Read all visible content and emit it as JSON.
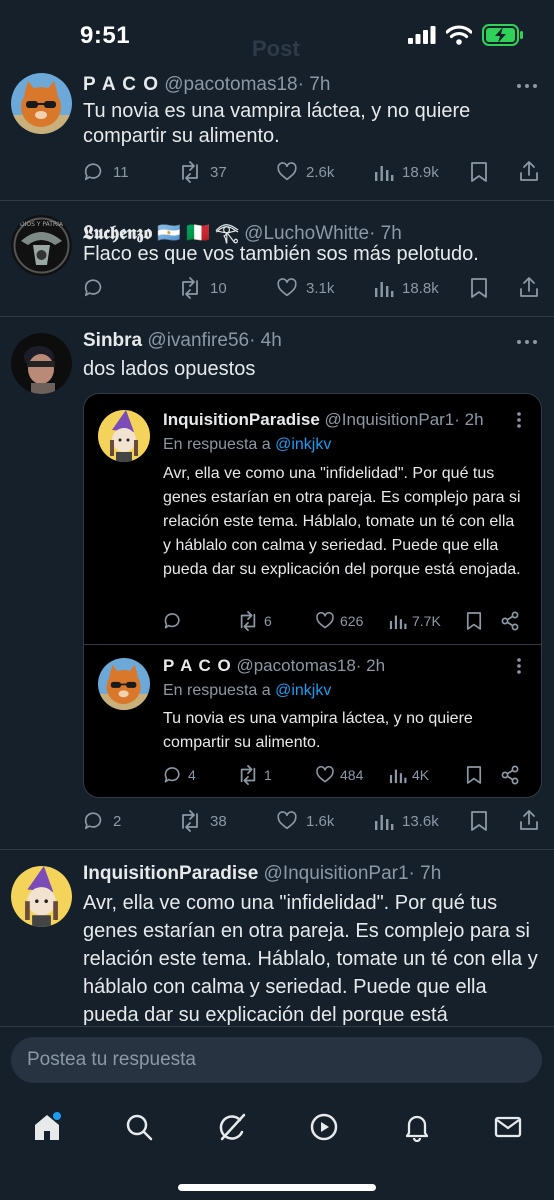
{
  "status_bar": {
    "time": "9:51"
  },
  "background_title": "Post",
  "tweets": [
    {
      "name": "P A C O",
      "handle": "@pacotomas18",
      "time": "· 7h",
      "text": "Tu novia es una vampira láctea, y no quiere compartir su alimento.",
      "replies": "11",
      "reposts": "37",
      "likes": "2.6k",
      "views": "18.9k"
    },
    {
      "name": "𝕷𝖚𝖈𝖍𝖊𝖓𝖟𝖔 🇦🇷 🇮🇹 𓂀",
      "handle": "@LuchoWhitte",
      "time": "· 7h",
      "text": "Flaco es que vos también sos más pelotudo.",
      "replies": "",
      "reposts": "10",
      "likes": "3.1k",
      "views": "18.8k"
    },
    {
      "name": "Sinbra",
      "handle": "@ivanfire56",
      "time": "· 4h",
      "text": "dos lados opuestos",
      "replies": "2",
      "reposts": "38",
      "likes": "1.6k",
      "views": "13.6k",
      "quotes": [
        {
          "name": "InquisitionParadise",
          "handle": "@InquisitionPar1",
          "time": "· 2h",
          "reply_prefix": "En respuesta a",
          "reply_to": "@inkjkv",
          "text": "Avr, ella ve como una \"infidelidad\". Por qué tus genes estarían en otra pareja. Es complejo para si relación este tema. Háblalo, tomate un té con ella y háblalo con calma y seriedad. Puede que ella pueda dar su explicación del porque está enojada.",
          "replies": "",
          "reposts": "6",
          "likes": "626",
          "views": "7.7K"
        },
        {
          "name": "P A C O",
          "handle": "@pacotomas18",
          "time": "· 2h",
          "reply_prefix": "En respuesta a",
          "reply_to": "@inkjkv",
          "text": "Tu novia es una vampira láctea, y no quiere compartir su alimento.",
          "replies": "4",
          "reposts": "1",
          "likes": "484",
          "views": "4K"
        }
      ]
    },
    {
      "name": "InquisitionParadise",
      "handle": "@InquisitionPar1",
      "time": "· 7h",
      "text": "Avr, ella ve como una \"infidelidad\". Por qué tus genes estarían en otra pareja. Es complejo para si relación este tema. Háblalo, tomate un té con ella y háblalo con calma y seriedad. Puede que ella pueda dar su explicación del porque está"
    }
  ],
  "reply_box": {
    "placeholder": "Postea tu respuesta"
  },
  "nav": [
    "home-icon",
    "search-icon",
    "grok-icon",
    "video-icon",
    "notifications-icon",
    "messages-icon"
  ],
  "colors": {
    "background": "#15202b",
    "link": "#1d9bf0",
    "secondary_text": "#8b98a5",
    "battery": "#30d158"
  }
}
